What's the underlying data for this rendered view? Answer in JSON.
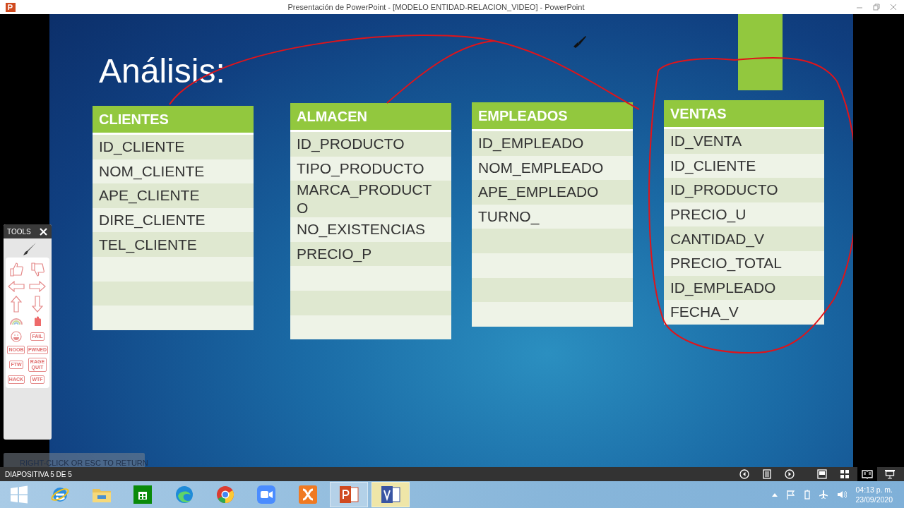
{
  "window": {
    "title": "Presentación de PowerPoint - [MODELO ENTIDAD-RELACION_VIDEO] - PowerPoint"
  },
  "slide": {
    "title": "Análisis:",
    "tables": [
      {
        "title": "CLIENTES",
        "rows": [
          {
            "kind": "field",
            "text": "ID_CLIENTE"
          },
          {
            "kind": "field",
            "text": "NOM_CLIENTE"
          },
          {
            "kind": "field",
            "text": "APE_CLIENTE"
          },
          {
            "kind": "field",
            "text": "DIRE_CLIENTE"
          },
          {
            "kind": "field",
            "text": "TEL_CLIENTE"
          },
          {
            "kind": "blank"
          },
          {
            "kind": "blank"
          },
          {
            "kind": "blank"
          }
        ]
      },
      {
        "title": "ALMACEN",
        "rows": [
          {
            "kind": "field",
            "text": "ID_PRODUCTO"
          },
          {
            "kind": "field",
            "text": "TIPO_PRODUCTO"
          },
          {
            "kind": "field",
            "text": "MARCA_PRODUCT O"
          },
          {
            "kind": "field",
            "text": "NO_EXISTENCIAS"
          },
          {
            "kind": "field",
            "text": "PRECIO_P"
          },
          {
            "kind": "blank"
          },
          {
            "kind": "blank"
          },
          {
            "kind": "blank"
          }
        ]
      },
      {
        "title": "EMPLEADOS",
        "rows": [
          {
            "kind": "field",
            "text": "ID_EMPLEADO"
          },
          {
            "kind": "field",
            "text": "NOM_EMPLEADO"
          },
          {
            "kind": "field",
            "text": "APE_EMPLEADO"
          },
          {
            "kind": "field",
            "text": "TURNO_"
          },
          {
            "kind": "blank"
          },
          {
            "kind": "blank"
          },
          {
            "kind": "blank"
          },
          {
            "kind": "blank"
          }
        ]
      },
      {
        "title": "VENTAS",
        "rows": [
          {
            "kind": "field",
            "text": "ID_VENTA"
          },
          {
            "kind": "field",
            "text": "ID_CLIENTE"
          },
          {
            "kind": "field",
            "text": "ID_PRODUCTO"
          },
          {
            "kind": "field",
            "text": "PRECIO_U"
          },
          {
            "kind": "field",
            "text": "CANTIDAD_V"
          },
          {
            "kind": "field",
            "text": "PRECIO_TOTAL"
          },
          {
            "kind": "field",
            "text": "ID_EMPLEADO"
          },
          {
            "kind": "field",
            "text": "FECHA_V"
          }
        ]
      }
    ]
  },
  "tools": {
    "title": "TOOLS",
    "stamps": [
      "FAIL",
      "NOOB",
      "PWNED",
      "FTW",
      "RAGE QUIT",
      "HACK",
      "WTF"
    ]
  },
  "return_hint": "RIGHT-CLICK OR ESC TO RETURN",
  "status_bar": {
    "slide_counter": "DIAPOSITIVA 5 DE 5",
    "view_buttons": [
      {
        "selected": false
      },
      {
        "selected": false
      },
      {
        "selected": false
      },
      {
        "selected": false
      },
      {
        "selected": false
      },
      {
        "selected": true
      },
      {
        "selected": false
      }
    ]
  },
  "taskbar": {
    "apps": [
      {
        "selected": false
      },
      {
        "selected": false
      },
      {
        "selected": false
      },
      {
        "selected": false
      },
      {
        "selected": false
      },
      {
        "selected": false
      },
      {
        "selected": false
      },
      {
        "selected": false
      },
      {
        "selected": true
      },
      {
        "selected": true
      }
    ],
    "time": "04:13 p. m.",
    "date": "23/09/2020"
  }
}
